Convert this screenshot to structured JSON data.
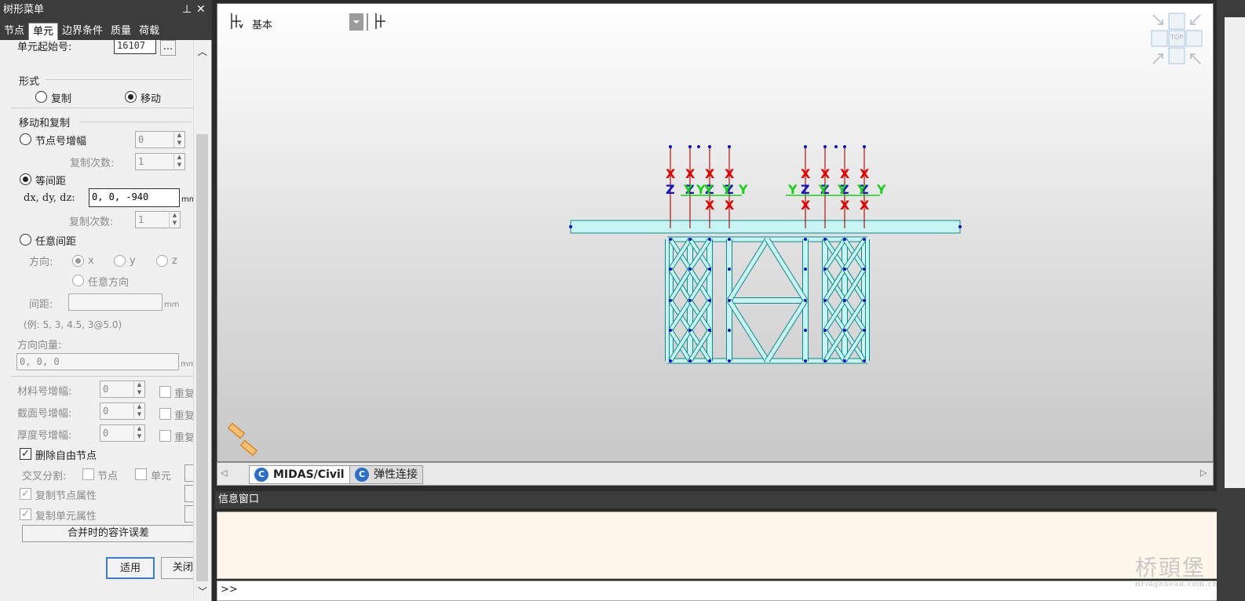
{
  "left_panel": {
    "title": "树形菜单",
    "pin_icon": "pin-icon",
    "close_icon": "close-icon",
    "tabs": [
      {
        "label": "节点"
      },
      {
        "label": "单元",
        "active": true
      },
      {
        "label": "边界条件"
      },
      {
        "label": "质量"
      },
      {
        "label": "荷载"
      }
    ],
    "start_no_label": "单元起始号:",
    "start_no_value": "16107",
    "ellipsis": "...",
    "form_section": "形式",
    "copy_label": "复制",
    "move_label": "移动",
    "move_copy_section": "移动和复制",
    "node_incr_label": "节点号增幅",
    "node_incr_value": "0",
    "copy_times_label": "复制次数:",
    "copy_times_value": "1",
    "equal_spacing_label": "等间距",
    "dxdydz_label": "dx, dy, dz:",
    "dxdydz_value": "0, 0, -940",
    "unit_mm": "mm",
    "copy_times2_label": "复制次数:",
    "copy_times2_value": "1",
    "arbitrary_label": "任意间距",
    "direction_label": "方向:",
    "dir_x": "x",
    "dir_y": "y",
    "dir_z": "z",
    "dir_any": "任意方向",
    "spacing_label": "间距:",
    "example": "(例: 5, 3, 4.5, 3@5.0)",
    "dir_vector_label": "方向向量:",
    "dir_vector_value": "0, 0, 0",
    "mat_incr_label": "材料号增幅:",
    "mat_incr_value": "0",
    "sec_incr_label": "截面号增幅:",
    "sec_incr_value": "0",
    "thk_incr_label": "厚度号增幅:",
    "thk_incr_value": "0",
    "repeat": "重复",
    "delete_free_nodes": "删除自由节点",
    "cross_split_label": "交叉分割:",
    "cross_node": "节点",
    "cross_elem": "单元",
    "copy_node_attr": "复制节点属性",
    "copy_elem_attr": "复制单元属性",
    "merge_tol": "合并时的容许误差",
    "apply": "适用",
    "close": "关闭"
  },
  "viewport": {
    "view_label": "基本",
    "view_cube_label": "TOP",
    "support_labels_x": "X",
    "support_labels_y": "Y",
    "support_labels_z": "Z"
  },
  "view_tabs": [
    {
      "label": "MIDAS/Civil",
      "active": true
    },
    {
      "label": "弹性连接"
    }
  ],
  "info_window": {
    "title": "信息窗口",
    "prompt": ">>"
  },
  "watermark": {
    "text": "桥頭堡",
    "url": "Bridgehead.com.cn"
  },
  "colors": {
    "member_fill": "#c8f4f4",
    "member_stroke": "#0f8a8a",
    "x_color": "#e00000",
    "y_color": "#18d018",
    "z_color": "#1010c8"
  }
}
